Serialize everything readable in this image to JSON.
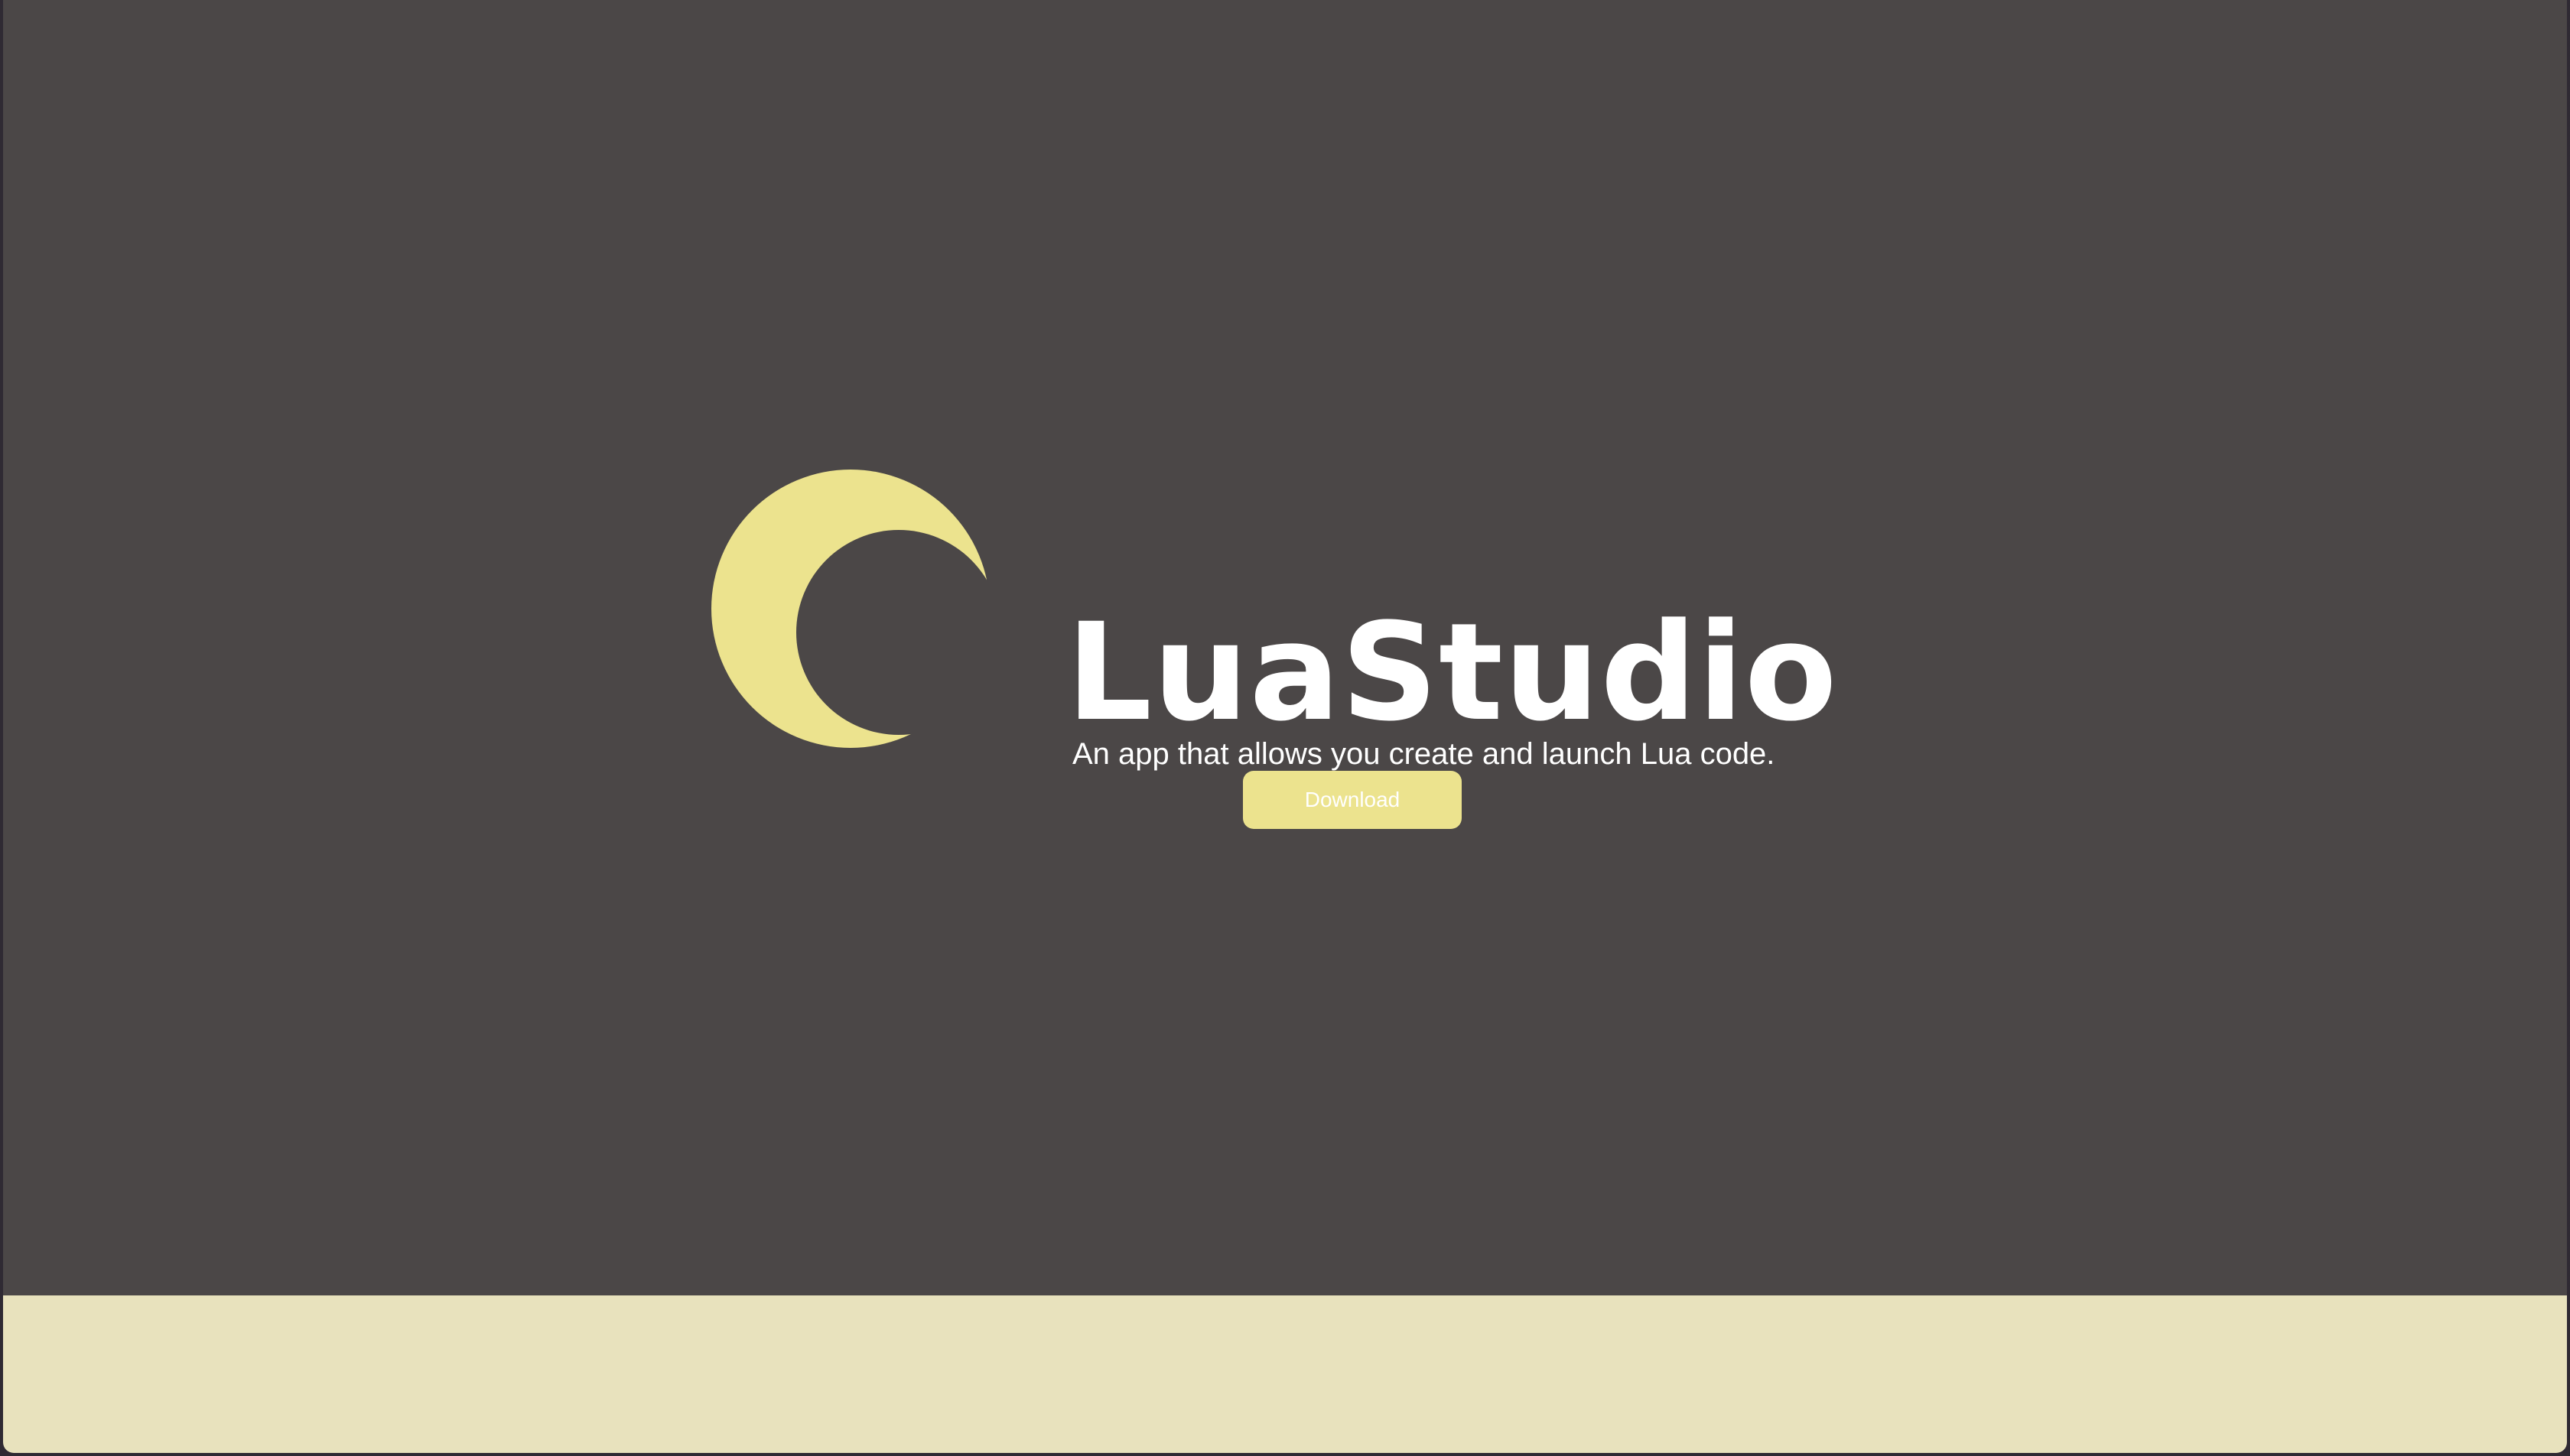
{
  "app": {
    "title": "LuaStudio",
    "tagline": "An app that allows you create and launch Lua code.",
    "download_label": "Download"
  },
  "logo": {
    "icon": "crescent-moon-icon",
    "color": "#ece38e"
  },
  "colors": {
    "background": "#4b4747",
    "footer": "#e8e2bd",
    "accent": "#ece38e",
    "text": "#ffffff"
  }
}
